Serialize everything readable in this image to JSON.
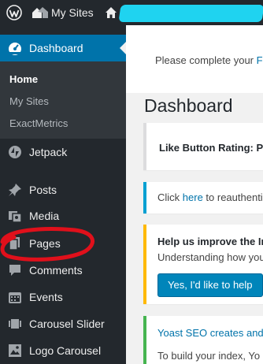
{
  "admin_bar": {
    "wp_logo_icon": "wordpress-icon",
    "my_sites_label": "My Sites",
    "my_sites_icon": "my-sites-icon",
    "home_icon": "home-icon",
    "redaction_color": "#1fd3f0"
  },
  "sidebar": {
    "dashboard": {
      "label": "Dashboard",
      "icon": "dashboard-gauge-icon"
    },
    "submenu": [
      {
        "label": "Home"
      },
      {
        "label": "My Sites"
      },
      {
        "label": "ExactMetrics"
      }
    ],
    "items": [
      {
        "label": "Jetpack",
        "icon": "jetpack-icon"
      },
      {
        "label": "Posts",
        "icon": "pushpin-icon"
      },
      {
        "label": "Media",
        "icon": "media-icon"
      },
      {
        "label": "Pages",
        "icon": "pages-icon"
      },
      {
        "label": "Comments",
        "icon": "comment-icon"
      },
      {
        "label": "Events",
        "icon": "calendar-icon"
      },
      {
        "label": "Carousel Slider",
        "icon": "slides-icon"
      },
      {
        "label": "Logo Carousel",
        "icon": "image-gallery-icon"
      }
    ],
    "highlight_color": "#e0101b"
  },
  "main": {
    "top_notice": {
      "text": "Please complete your ",
      "link": "F"
    },
    "title": "Dashboard",
    "like_card": {
      "text": "Like Button Rating: Pl"
    },
    "reauth_card": {
      "before": "Click ",
      "link": "here",
      "after": " to reauthenti"
    },
    "improve_card": {
      "heading": "Help us improve the In",
      "text": "Understanding how you",
      "button": "Yes, I'd like to help"
    },
    "yoast_card": {
      "heading": "Yoast SEO creates and",
      "text": "To build your index, Yo"
    }
  },
  "colors": {
    "accent": "#0073aa",
    "sidebar": "#23282d",
    "submenu": "#32373c",
    "warning": "#ffb900",
    "info": "#00a0d2",
    "success": "#46b450"
  }
}
